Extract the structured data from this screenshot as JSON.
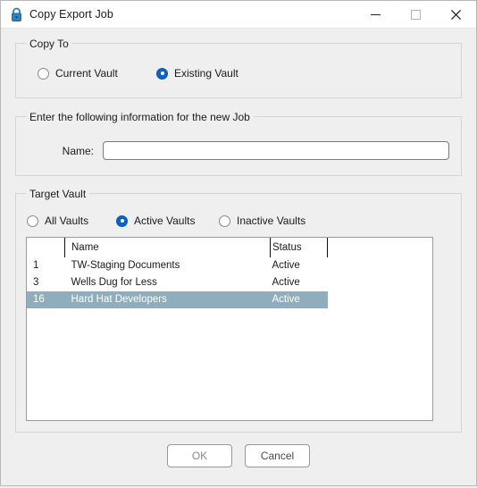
{
  "window": {
    "title": "Copy Export Job",
    "lock_icon": "lock-icon",
    "controls": {
      "minimize": "minimize-icon",
      "maximize": "maximize-icon",
      "close": "close-icon"
    }
  },
  "copy_to": {
    "legend": "Copy To",
    "options": [
      {
        "label": "Current Vault",
        "checked": false
      },
      {
        "label": "Existing Vault",
        "checked": true
      }
    ]
  },
  "new_job": {
    "legend": "Enter the following information for the new Job",
    "name_label": "Name:",
    "name_value": "",
    "name_placeholder": ""
  },
  "target_vault": {
    "legend": "Target Vault",
    "options": [
      {
        "label": "All Vaults",
        "checked": false
      },
      {
        "label": "Active Vaults",
        "checked": true
      },
      {
        "label": "Inactive Vaults",
        "checked": false
      }
    ],
    "columns": [
      "",
      "Name",
      "Status"
    ],
    "rows": [
      {
        "id": "1",
        "name": "TW-Staging Documents",
        "status": "Active",
        "selected": false
      },
      {
        "id": "3",
        "name": "Wells Dug for Less",
        "status": "Active",
        "selected": false
      },
      {
        "id": "16",
        "name": "Hard Hat Developers",
        "status": "Active",
        "selected": true
      }
    ]
  },
  "footer": {
    "ok_label": "OK",
    "cancel_label": "Cancel"
  },
  "colors": {
    "accent_radio": "#0a63c4",
    "selection_row": "#8eadbd",
    "window_bg": "#efefef",
    "titlebar_bg": "#ffffff",
    "lock_blue": "#1f6fa8"
  }
}
